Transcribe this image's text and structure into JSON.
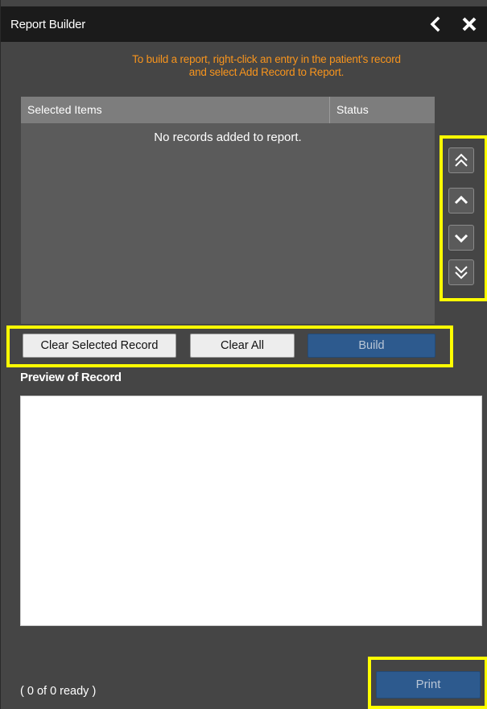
{
  "window": {
    "title": "Report Builder",
    "back_icon": "chevron-left-icon",
    "close_icon": "close-icon"
  },
  "instruction": {
    "line1": "To build a report, right-click an entry in the patient's record",
    "line2": "and select Add Record to Report.",
    "color": "#f7941d"
  },
  "table": {
    "columns": [
      "Selected Items",
      "Status"
    ],
    "empty_message": "No records added to report.",
    "rows": []
  },
  "reorder_buttons": [
    {
      "name": "move-to-top",
      "icon": "double-chevron-up-icon"
    },
    {
      "name": "move-up",
      "icon": "chevron-up-icon"
    },
    {
      "name": "move-down",
      "icon": "chevron-down-icon"
    },
    {
      "name": "move-to-bottom",
      "icon": "double-chevron-down-icon"
    }
  ],
  "actions": {
    "clear_selected": "Clear Selected Record",
    "clear_all": "Clear All",
    "build": "Build"
  },
  "preview": {
    "label": "Preview of Record",
    "content": ""
  },
  "footer": {
    "status": "( 0 of 0 ready )",
    "print": "Print"
  },
  "colors": {
    "panel_bg": "#454545",
    "titlebar_bg": "#1b1b1b",
    "highlight": "#ffff00",
    "primary_button": "#2d5a8e"
  }
}
